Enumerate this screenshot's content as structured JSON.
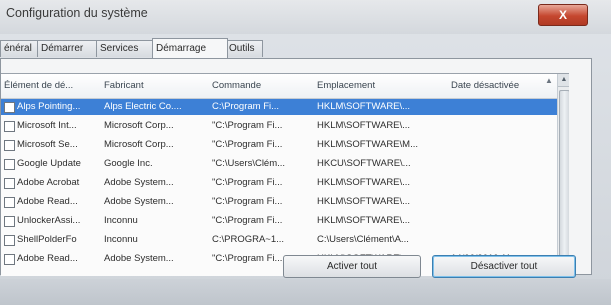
{
  "window": {
    "title": "Configuration du système",
    "close_label": "X"
  },
  "tabs": [
    {
      "label": "énéral",
      "active": false
    },
    {
      "label": "Démarrer",
      "active": false
    },
    {
      "label": "Services",
      "active": false
    },
    {
      "label": "Démarrage",
      "active": true
    },
    {
      "label": "Outils",
      "active": false
    }
  ],
  "table": {
    "columns": [
      "Élément de dé...",
      "Fabricant",
      "Commande",
      "Emplacement",
      "Date désactivée"
    ],
    "rows": [
      {
        "name": "Alps Pointing...",
        "maker": "Alps Electric Co....",
        "command": "C:\\Program Fi...",
        "location": "HKLM\\SOFTWARE\\...",
        "date": "",
        "selected": true
      },
      {
        "name": "Microsoft Int...",
        "maker": "Microsoft Corp...",
        "command": "\"C:\\Program Fi...",
        "location": "HKLM\\SOFTWARE\\...",
        "date": "",
        "selected": false
      },
      {
        "name": "Microsoft Se...",
        "maker": "Microsoft Corp...",
        "command": "\"C:\\Program Fi...",
        "location": "HKLM\\SOFTWARE\\M...",
        "date": "",
        "selected": false
      },
      {
        "name": "Google Update",
        "maker": "Google Inc.",
        "command": "\"C:\\Users\\Clém...",
        "location": "HKCU\\SOFTWARE\\...",
        "date": "",
        "selected": false
      },
      {
        "name": "Adobe Acrobat",
        "maker": "Adobe System...",
        "command": "\"C:\\Program Fi...",
        "location": "HKLM\\SOFTWARE\\...",
        "date": "",
        "selected": false
      },
      {
        "name": "Adobe Read...",
        "maker": "Adobe System...",
        "command": "\"C:\\Program Fi...",
        "location": "HKLM\\SOFTWARE\\...",
        "date": "",
        "selected": false
      },
      {
        "name": "UnlockerAssi...",
        "maker": "Inconnu",
        "command": "\"C:\\Program Fi...",
        "location": "HKLM\\SOFTWARE\\...",
        "date": "",
        "selected": false
      },
      {
        "name": "ShellPolderFo",
        "maker": "Inconnu",
        "command": "C:\\PROGRA~1...",
        "location": "C:\\Users\\Clément\\A...",
        "date": "",
        "selected": false
      },
      {
        "name": "Adobe Read...",
        "maker": "Adobe System...",
        "command": "\"C:\\Program Fi...",
        "location": "HKLM\\SOFTWARE\\...",
        "date": "14/06/2010 11...",
        "selected": false
      }
    ]
  },
  "buttons": {
    "enable_all": "Activer tout",
    "disable_all": "Désactiver tout"
  },
  "colors": {
    "selection": "#3d80d6",
    "close_button": "#c5472f"
  },
  "icons": {
    "close": "close-icon",
    "checkbox": "checkbox",
    "sort": "chevron-up-icon"
  }
}
